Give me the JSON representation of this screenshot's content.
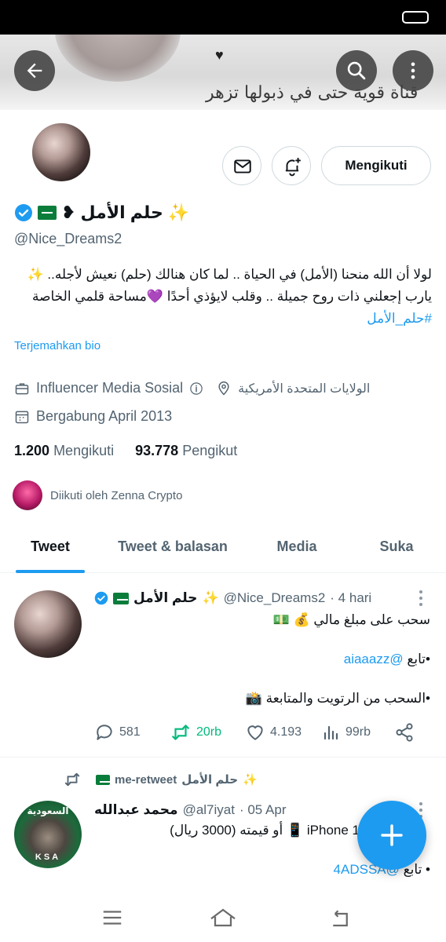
{
  "banner": {
    "text": "قناة قوية حتى في ذبولها تزهر",
    "heart": "♥"
  },
  "profile": {
    "display_name": "حلم الأمل",
    "name_suffix": "❥",
    "sparkle": "✨",
    "handle": "@Nice_Dreams2",
    "bio_line1": "لولا أن الله منحنا (الأمل) في الحياة .. لما كان هنالك (حلم) نعيش لأجله..",
    "bio_line1_emoji": "✨",
    "bio_line2": "يارب إجعلني ذات روح جميلة .. وقلب لايؤذي أحدًا",
    "bio_line2_emoji": "💜",
    "bio_line2_tail": "مساحة قلمي الخاصة",
    "bio_hashtag": "#حلم_الأمل",
    "translate": "Terjemahkan bio",
    "category": "Influencer Media Sosial",
    "location": "الولايات المتحدة الأمريكية",
    "joined": "Bergabung April 2013",
    "following_count": "1.200",
    "following_label": "Mengikuti",
    "followers_count": "93.778",
    "followers_label": "Pengikut",
    "followed_by": "Diikuti oleh Zenna Crypto",
    "follow_button": "Mengikuti"
  },
  "tabs": [
    "Tweet",
    "Tweet & balasan",
    "Media",
    "Suka"
  ],
  "tweets": [
    {
      "name": "حلم الأمل",
      "sparkle": "✨",
      "handle": "@Nice_Dreams2",
      "time": "· 4 hari",
      "line1": "سحب على مبلغ مالي",
      "line1_emoji": "💰 💵",
      "line2_prefix": "•تابع",
      "line2_link": "@aiaaazz",
      "line3": "•السحب من الرتويت والمتابعة",
      "line3_emoji": "📸",
      "replies": "581",
      "retweets": "20rb",
      "likes": "4.193",
      "views": "99rb"
    },
    {
      "retweet_label": "me-retweet",
      "retweeter": "حلم الأمل",
      "name": "محمد عبدالله",
      "handle": "@al7iyat",
      "time": "· 05 Apr",
      "line1": "iPhone 1",
      "line1_tail": "أو قيمته (3000 ريال)",
      "line1_emoji": "📱",
      "line2_prefix": "• تابع",
      "line2_link": "@4ADSSA",
      "avatar_top": "السعودية",
      "avatar_bottom": "KSA"
    }
  ],
  "colors": {
    "accent": "#1d9bf0",
    "retweet": "#00ba7c",
    "muted": "#536471"
  }
}
